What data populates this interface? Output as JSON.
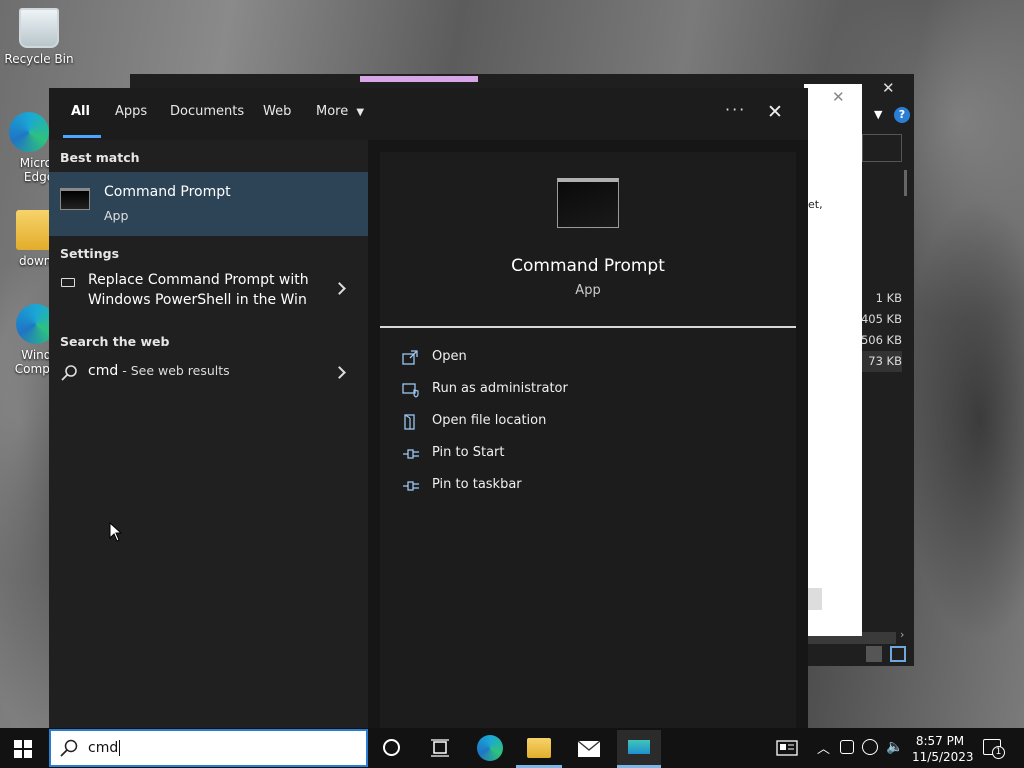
{
  "desktop": {
    "icons": [
      {
        "label": "Recycle Bin"
      },
      {
        "label": "Micros Edge"
      },
      {
        "label": "downg"
      },
      {
        "label": "Windo Compati"
      }
    ]
  },
  "background_window": {
    "partial_text": "et,",
    "file_sizes": [
      "1 KB",
      "405 KB",
      "506 KB",
      "73 KB"
    ]
  },
  "search_panel": {
    "tabs": [
      {
        "label": "All"
      },
      {
        "label": "Apps"
      },
      {
        "label": "Documents"
      },
      {
        "label": "Web"
      },
      {
        "label": "More"
      }
    ],
    "left": {
      "best_match_heading": "Best match",
      "best_match": {
        "title": "Command Prompt",
        "subtitle": "App"
      },
      "settings_heading": "Settings",
      "settings_item": {
        "line1": "Replace Command Prompt with",
        "line2": "Windows PowerShell in the Win"
      },
      "web_heading": "Search the web",
      "web_item": {
        "query": "cmd",
        "suffix": " - See web results"
      }
    },
    "right": {
      "app_title": "Command Prompt",
      "app_subtitle": "App",
      "actions": [
        {
          "label": "Open",
          "icon": "open-icon"
        },
        {
          "label": "Run as administrator",
          "icon": "shield-icon"
        },
        {
          "label": "Open file location",
          "icon": "file-location-icon"
        },
        {
          "label": "Pin to Start",
          "icon": "pin-icon"
        },
        {
          "label": "Pin to taskbar",
          "icon": "pin-icon"
        }
      ]
    }
  },
  "taskbar": {
    "search_value": "cmd",
    "time": "8:57 PM",
    "date": "11/5/2023",
    "notification_count": "1"
  },
  "colors": {
    "accent": "#2d4457",
    "tab_underline": "#4ca6ff",
    "search_border": "#2a7fd4"
  }
}
